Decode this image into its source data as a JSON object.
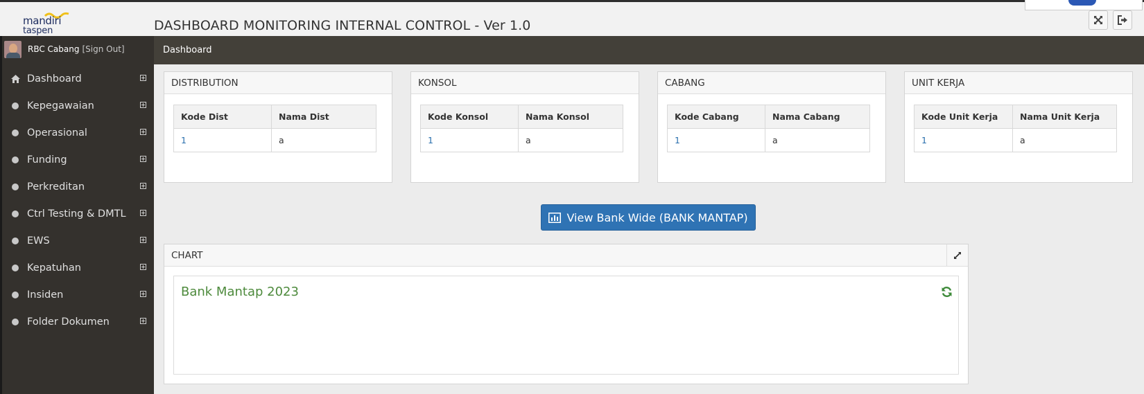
{
  "header": {
    "logo_line1": "mandiri",
    "logo_line2": "taspen",
    "title": "DASHBOARD MONITORING INTERNAL CONTROL - Ver 1.0"
  },
  "user": {
    "name": "RBC Cabang",
    "signout": "[Sign Out]"
  },
  "sidebar": {
    "items": [
      {
        "label": "Dashboard",
        "icon": "home-icon"
      },
      {
        "label": "Kepegawaian",
        "icon": "circle-icon"
      },
      {
        "label": "Operasional",
        "icon": "circle-icon"
      },
      {
        "label": "Funding",
        "icon": "circle-icon"
      },
      {
        "label": "Perkreditan",
        "icon": "circle-icon"
      },
      {
        "label": "Ctrl Testing & DMTL",
        "icon": "circle-icon"
      },
      {
        "label": "EWS",
        "icon": "circle-icon"
      },
      {
        "label": "Kepatuhan",
        "icon": "circle-icon"
      },
      {
        "label": "Insiden",
        "icon": "circle-icon"
      },
      {
        "label": "Folder Dokumen",
        "icon": "circle-icon"
      }
    ]
  },
  "breadcrumb": "Dashboard",
  "panels": [
    {
      "title": "DISTRIBUTION",
      "headers": [
        "Kode Dist",
        "Nama Dist"
      ],
      "rows": [
        [
          "1",
          "a"
        ]
      ]
    },
    {
      "title": "KONSOL",
      "headers": [
        "Kode Konsol",
        "Nama Konsol"
      ],
      "rows": [
        [
          "1",
          "a"
        ]
      ]
    },
    {
      "title": "CABANG",
      "headers": [
        "Kode Cabang",
        "Nama Cabang"
      ],
      "rows": [
        [
          "1",
          "a"
        ]
      ]
    },
    {
      "title": "UNIT KERJA",
      "headers": [
        "Kode Unit Kerja",
        "Nama Unit Kerja"
      ],
      "rows": [
        [
          "1",
          "a"
        ]
      ]
    }
  ],
  "view_button": "View Bank Wide (BANK MANTAP)",
  "chart_panel": {
    "title": "CHART",
    "chart_title": "Bank Mantap 2023"
  },
  "colors": {
    "sidebar": "#34312d",
    "breadcrumb_bar": "#434039",
    "primary_button": "#2f73b4",
    "link": "#2a6fad",
    "chart_title": "#4d8a3c"
  }
}
